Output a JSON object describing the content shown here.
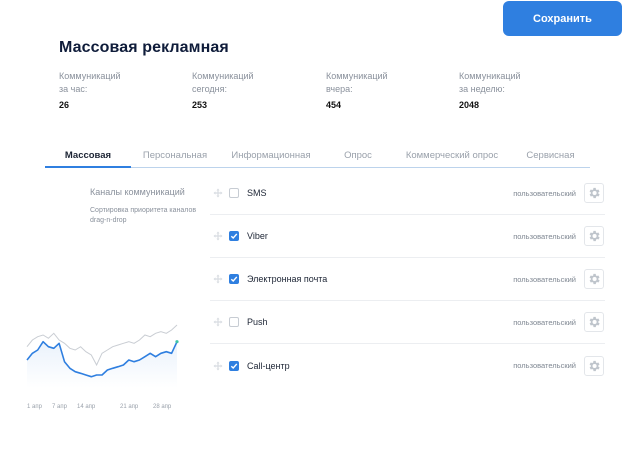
{
  "header": {
    "save_label": "Сохранить",
    "title": "Массовая рекламная"
  },
  "stats": [
    {
      "label": "Коммуникаций\nза час:",
      "value": "26"
    },
    {
      "label": "Коммуникаций\nсегодня:",
      "value": "253"
    },
    {
      "label": "Коммуникаций\nвчера:",
      "value": "454"
    },
    {
      "label": "Коммуникаций\nза неделю:",
      "value": "2048"
    }
  ],
  "tabs": [
    {
      "label": "Массовая",
      "active": true
    },
    {
      "label": "Персональная"
    },
    {
      "label": "Информационная"
    },
    {
      "label": "Опрос"
    },
    {
      "label": "Коммерческий опрос"
    },
    {
      "label": "Сервисная"
    }
  ],
  "channels_section": {
    "title": "Каналы коммуникаций",
    "hint": "Сортировка приоритета каналов drag-n-drop"
  },
  "channels": [
    {
      "name": "SMS",
      "checked": false,
      "mode": "пользовательский"
    },
    {
      "name": "Viber",
      "checked": true,
      "mode": "пользовательский"
    },
    {
      "name": "Электронная почта",
      "checked": true,
      "mode": "пользовательский"
    },
    {
      "name": "Push",
      "checked": false,
      "mode": "пользовательский"
    },
    {
      "name": "Call-центр",
      "checked": true,
      "mode": "пользовательский"
    }
  ],
  "colors": {
    "accent": "#2f7fe0",
    "secondary_line": "#c9cdd3",
    "end_point": "#3cc3a8"
  },
  "chart_data": {
    "type": "line",
    "categories": [
      "1 апр",
      "7 апр",
      "14 апр",
      "21 апр",
      "28 апр"
    ],
    "x": [
      1,
      2,
      3,
      4,
      5,
      6,
      7,
      8,
      9,
      10,
      11,
      12,
      13,
      14,
      15,
      16,
      17,
      18,
      19,
      20,
      21,
      22,
      23,
      24,
      25,
      26,
      27,
      28,
      29
    ],
    "series": [
      {
        "values": [
          20,
          24,
          26,
          27,
          25,
          28,
          24,
          22,
          19,
          18,
          20,
          17,
          15,
          9,
          16,
          18,
          20,
          21,
          22,
          23,
          22,
          24,
          27,
          26,
          28,
          29,
          28,
          30,
          33
        ]
      },
      {
        "values": [
          12,
          16,
          18,
          23,
          20,
          19,
          22,
          11,
          7,
          5,
          4,
          3,
          2,
          3,
          3,
          6,
          7,
          8,
          9,
          12,
          11,
          12,
          14,
          16,
          14,
          16,
          17,
          16,
          23
        ]
      }
    ],
    "ylim": [
      0,
      36
    ],
    "grid": false
  }
}
